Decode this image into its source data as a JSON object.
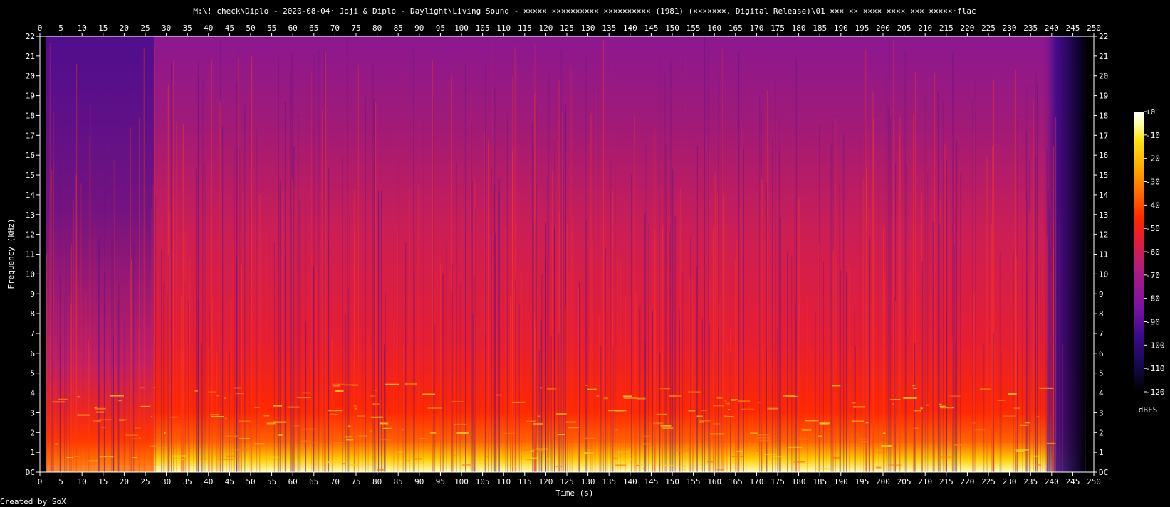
{
  "chart_data": {
    "type": "heatmap",
    "title": "M:\\! check\\Diplo - 2020-08-04· Joji & Diplo - Daylight\\Living Sound - ××××× ×××××××××× ×××××××××× (1981) (×××××××, Digital Release)\\01 ××× ×× ×××× ×××× ××× ×××××·flac",
    "xlabel": "Time (s)",
    "ylabel": "Frequency (kHz)",
    "xlim": [
      0,
      250
    ],
    "ylim": [
      0,
      22
    ],
    "x_ticks": [
      "0",
      "5",
      "10",
      "15",
      "20",
      "25",
      "30",
      "35",
      "40",
      "45",
      "50",
      "55",
      "60",
      "65",
      "70",
      "75",
      "80",
      "85",
      "90",
      "95",
      "100",
      "105",
      "110",
      "115",
      "120",
      "125",
      "130",
      "135",
      "140",
      "145",
      "150",
      "155",
      "160",
      "165",
      "170",
      "175",
      "180",
      "185",
      "190",
      "195",
      "200",
      "205",
      "210",
      "215",
      "220",
      "225",
      "230",
      "235",
      "240",
      "245",
      "250"
    ],
    "y_ticks": [
      "DC",
      "1",
      "2",
      "3",
      "4",
      "5",
      "6",
      "7",
      "8",
      "9",
      "10",
      "11",
      "12",
      "13",
      "14",
      "15",
      "16",
      "17",
      "18",
      "19",
      "20",
      "21",
      "22"
    ],
    "signal_time_range": [
      1.5,
      248
    ],
    "colorbar": {
      "unit": "dBFS",
      "ticks": [
        "+0",
        "-10",
        "-20",
        "-30",
        "-40",
        "-50",
        "-60",
        "-70",
        "-80",
        "-90",
        "-100",
        "-110",
        "-120"
      ],
      "colors": [
        "#000000",
        "#140a46",
        "#3c0a8c",
        "#7814a0",
        "#b41e78",
        "#e61e32",
        "#ff2800",
        "#ff6400",
        "#ffaa00",
        "#ffe614",
        "#ffffb4",
        "#ffffff"
      ]
    },
    "grid": false,
    "legend": "right"
  },
  "footer": "Created by SoX"
}
